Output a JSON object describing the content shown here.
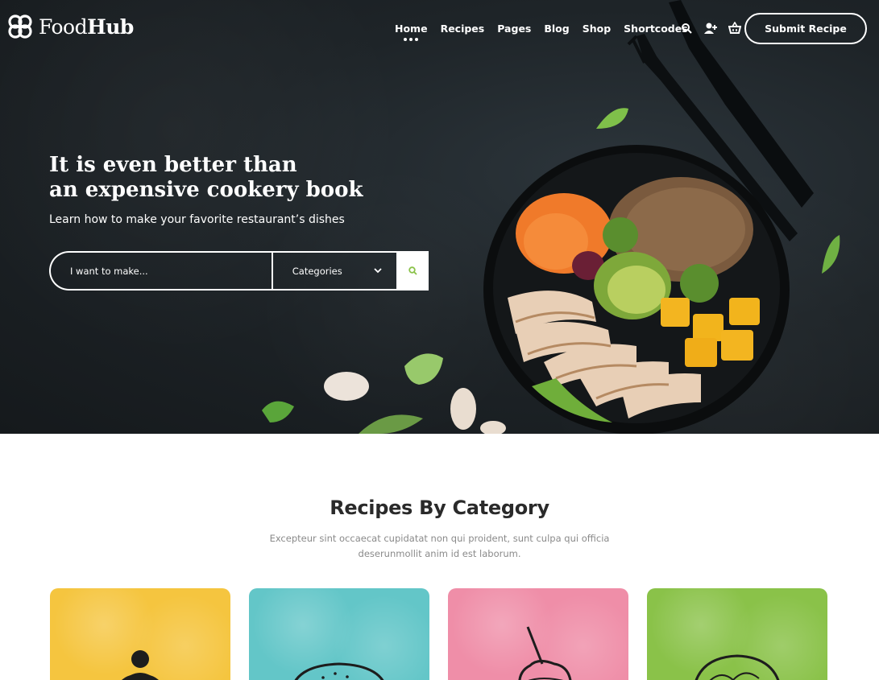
{
  "brand": {
    "name_light": "Food",
    "name_bold": "Hub"
  },
  "nav": {
    "items": [
      {
        "label": "Home"
      },
      {
        "label": "Recipes"
      },
      {
        "label": "Pages"
      },
      {
        "label": "Blog"
      },
      {
        "label": "Shop"
      },
      {
        "label": "Shortcodes"
      }
    ],
    "submit_label": "Submit Recipe"
  },
  "header_icons": [
    "search-icon",
    "add-user-icon",
    "basket-icon"
  ],
  "hero": {
    "title_line1": "It is even better than",
    "title_line2": "an expensive cookery book",
    "subtitle": "Learn how to make your favorite restaurant’s dishes",
    "search_placeholder": "I want to make...",
    "category_label": "Categories"
  },
  "section": {
    "title": "Recipes By Category",
    "description": "Excepteur sint occaecat cupidatat non qui proident, sunt culpa qui officia deserunmollit anim id est laborum."
  },
  "category_cards": [
    {
      "color": "#f5c53f",
      "icon": "cake-icon"
    },
    {
      "color": "#63c6c8",
      "icon": "burger-icon"
    },
    {
      "color": "#ef8ea8",
      "icon": "dessert-icon"
    },
    {
      "color": "#8ac249",
      "icon": "salad-icon"
    }
  ],
  "colors": {
    "accent": "#8ac249",
    "hero_bg": "#1e2428",
    "text_dark": "#2a2a2a"
  }
}
